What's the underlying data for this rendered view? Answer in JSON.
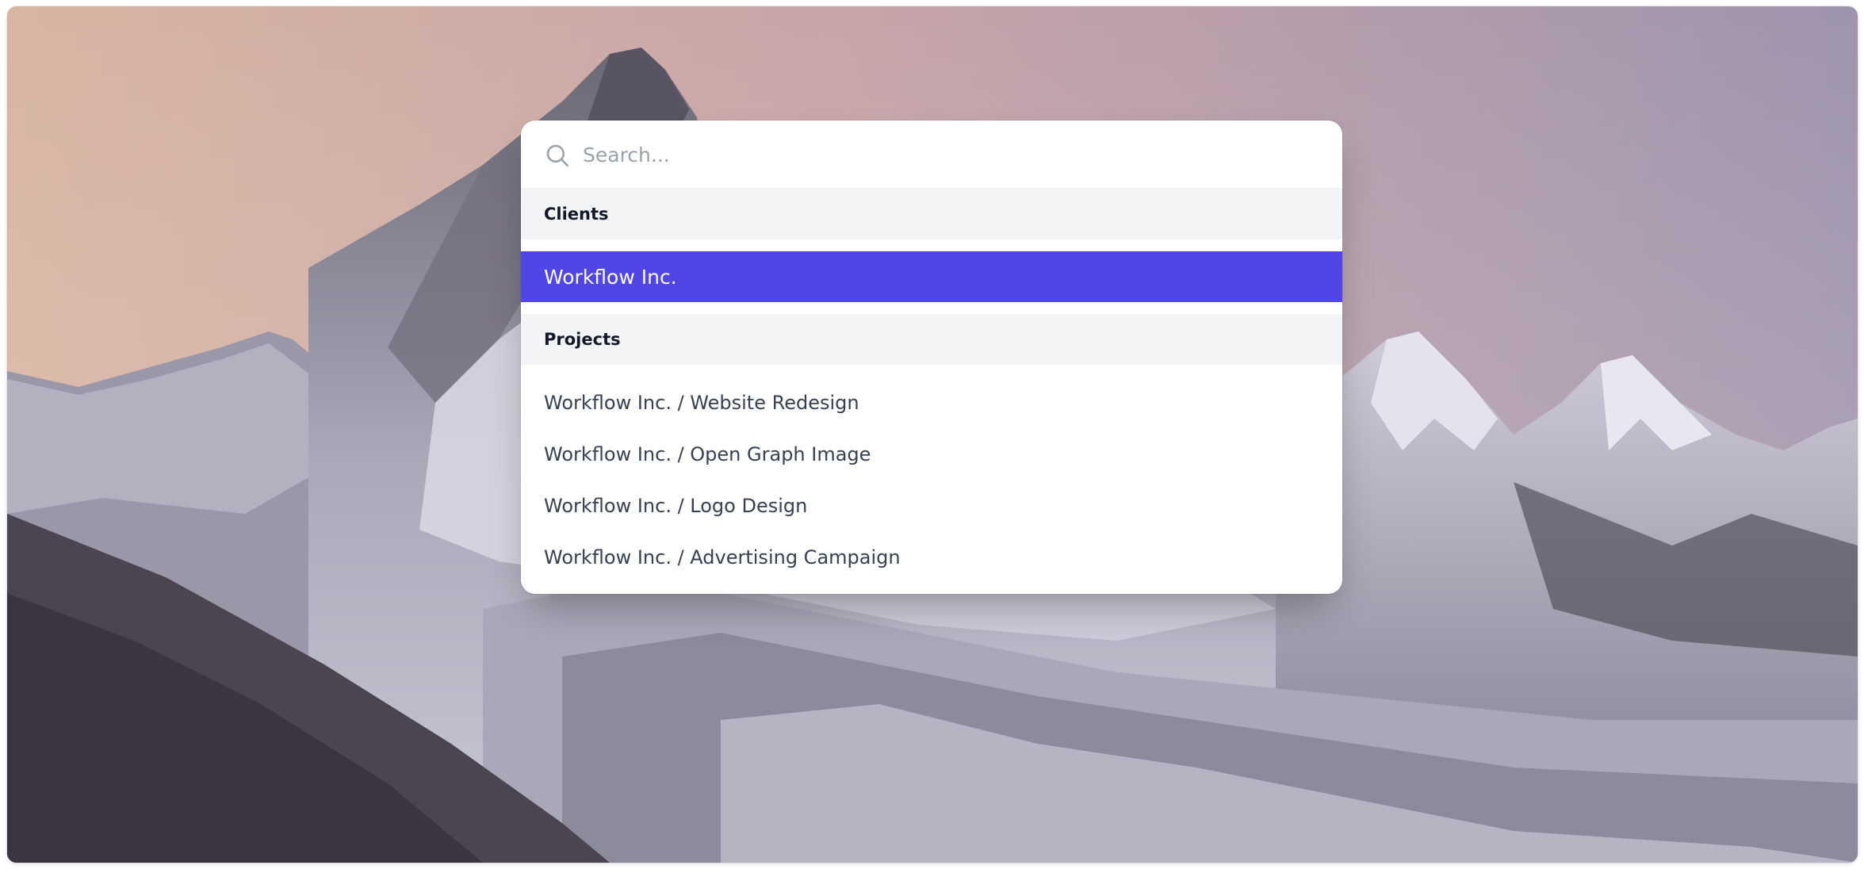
{
  "search": {
    "placeholder": "Search..."
  },
  "groups": {
    "clients": {
      "heading": "Clients",
      "items": [
        "Workflow Inc."
      ]
    },
    "projects": {
      "heading": "Projects",
      "items": [
        "Workflow Inc. / Website Redesign",
        "Workflow Inc. / Open Graph Image",
        "Workflow Inc. / Logo Design",
        "Workflow Inc. / Advertising Campaign"
      ]
    }
  },
  "colors": {
    "accent": "#4f46e5",
    "group_header_bg": "#f3f4f6"
  },
  "icons": {
    "search": "search-icon"
  }
}
